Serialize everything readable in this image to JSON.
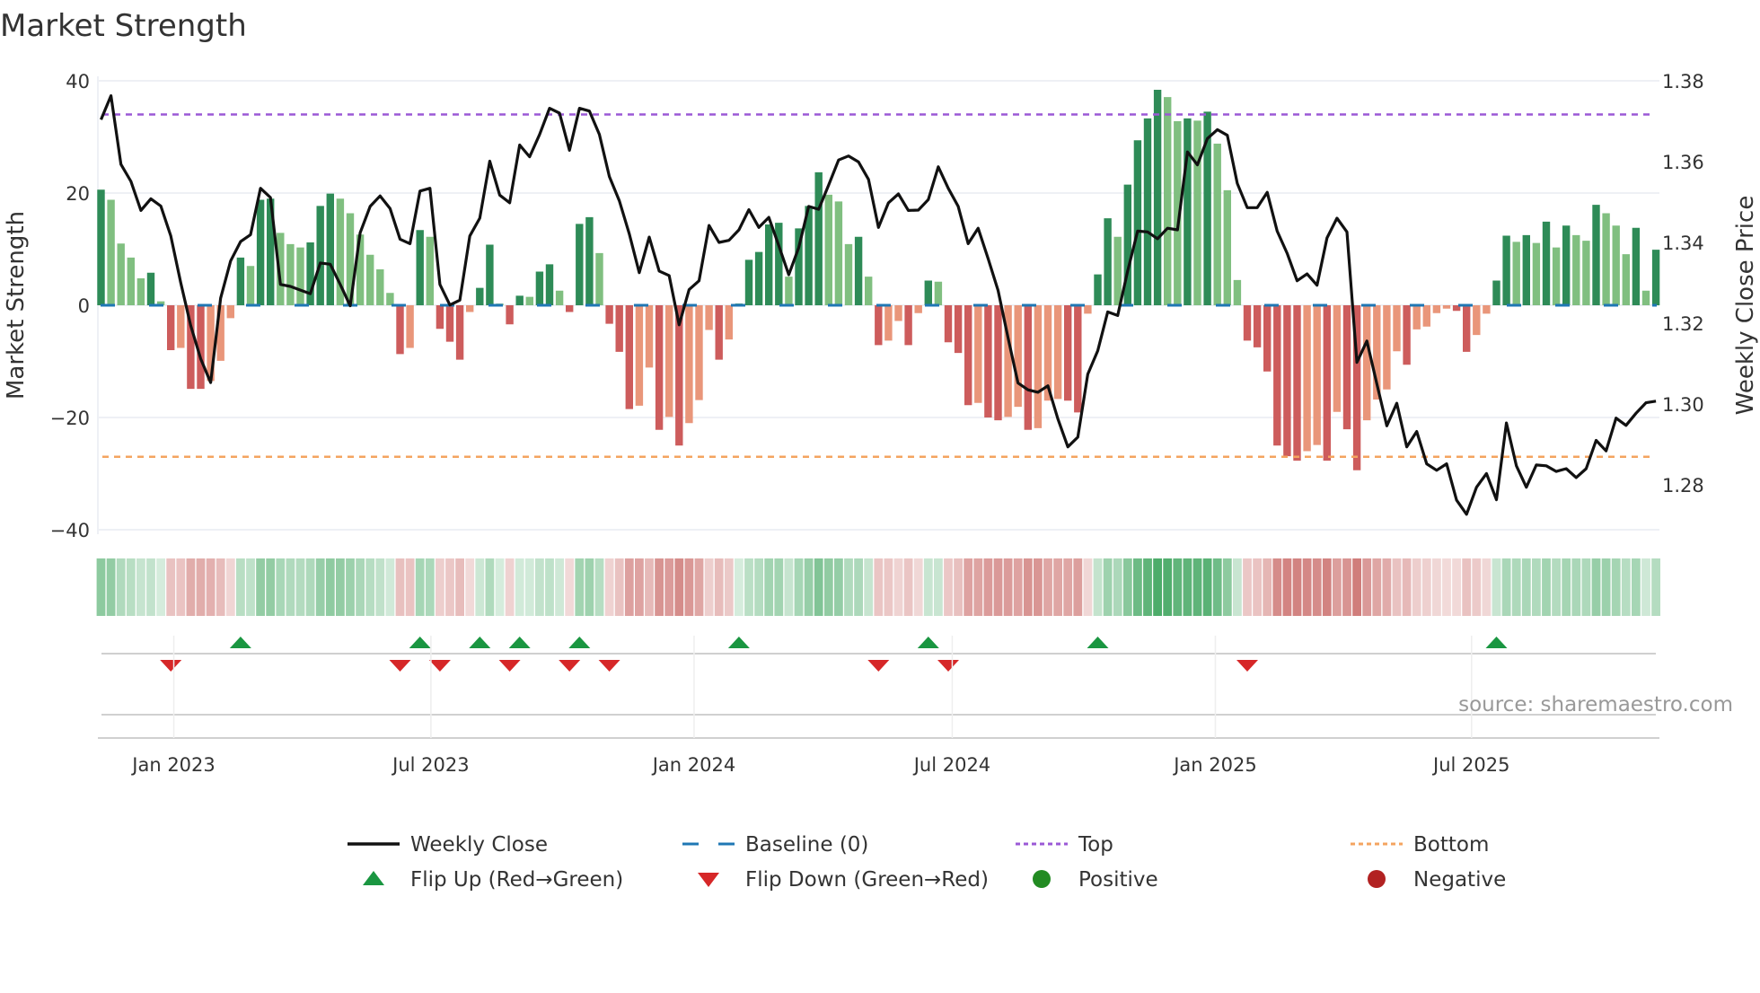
{
  "chart_data": {
    "type": "bar",
    "title": "Market Strength",
    "ylabel": "Market Strength",
    "y2label": "Weekly Close Price",
    "ylim": [
      -40,
      40
    ],
    "y2lim": [
      1.28,
      1.38
    ],
    "yticks": [
      "40",
      "20",
      "0",
      "−20",
      "−40"
    ],
    "yticks_values": [
      40,
      20,
      0,
      -20,
      -40
    ],
    "y2ticks": [
      "1.38",
      "1.36",
      "1.34",
      "1.32",
      "1.30",
      "1.28"
    ],
    "y2ticks_values": [
      1.38,
      1.36,
      1.34,
      1.32,
      1.3,
      1.28
    ],
    "xticks": [
      {
        "label": "Jan 2023",
        "week": 8.3
      },
      {
        "label": "Jul 2023",
        "week": 34.1
      },
      {
        "label": "Jan 2024",
        "week": 60.5
      },
      {
        "label": "Jul 2024",
        "week": 86.4
      },
      {
        "label": "Jan 2025",
        "week": 112.8
      },
      {
        "label": "Jul 2025",
        "week": 138.5
      }
    ],
    "top_level": 34,
    "bottom_level": -27,
    "baseline": 0,
    "strength": [
      20.6,
      18.8,
      11,
      8.5,
      4.8,
      5.8,
      0.7,
      -8,
      -7.6,
      -14.9,
      -14.9,
      -13.5,
      -9.9,
      -2.3,
      8.5,
      7,
      18.8,
      19,
      12.9,
      10.9,
      10.3,
      11.2,
      17.7,
      19.9,
      19,
      16.4,
      12.6,
      9,
      6.4,
      2.2,
      -8.7,
      -7.6,
      13.4,
      12.2,
      -4.2,
      -6.5,
      -9.7,
      -1.2,
      3.1,
      10.8,
      0.3,
      -3.4,
      1.7,
      1.5,
      6,
      7.3,
      2.6,
      -1.2,
      14.5,
      15.7,
      9.3,
      -3.3,
      -8.3,
      -18.5,
      -17.9,
      -11.1,
      -22.2,
      -19.9,
      -25,
      -21,
      -16.9,
      -4.4,
      -9.7,
      -6.1,
      0.3,
      8.1,
      9.5,
      14.4,
      14.7,
      5.1,
      13.7,
      17.7,
      23.7,
      19.7,
      18.5,
      10.9,
      12.2,
      5.1,
      -7.1,
      -6.3,
      -2.8,
      -7.1,
      -1.4,
      4.4,
      4.2,
      -6.6,
      -8.5,
      -17.8,
      -17.4,
      -20,
      -20.5,
      -19.9,
      -18.1,
      -22.2,
      -21.9,
      -17,
      -16.7,
      -17,
      -19.1,
      -1.5,
      5.5,
      15.5,
      12.2,
      21.5,
      29.4,
      33.3,
      38.4,
      37.1,
      32.8,
      33.3,
      32.9,
      34.5,
      28.8,
      20.5,
      4.5,
      -6.3,
      -7.5,
      -11.8,
      -25,
      -26.9,
      -27.7,
      -26,
      -24.9,
      -27.7,
      -19,
      -22.1,
      -29.4,
      -20.5,
      -16.8,
      -15,
      -8.2,
      -10.6,
      -4.3,
      -3.8,
      -1.4,
      -0.6,
      -1,
      -8.3,
      -5.3,
      -1.5,
      4.4,
      12.4,
      11.3,
      12.5,
      11.1,
      14.9,
      10.3,
      14.2,
      12.5,
      11.5,
      17.9,
      16.4,
      14.2,
      9.1,
      13.8,
      2.6,
      9.9
    ],
    "weekly_close": [
      1.3704,
      1.3763,
      1.3593,
      1.3551,
      1.3479,
      1.3508,
      1.349,
      1.3416,
      1.33,
      1.3194,
      1.3112,
      1.3053,
      1.3262,
      1.3354,
      1.3402,
      1.3419,
      1.3534,
      1.3511,
      1.3296,
      1.3291,
      1.3282,
      1.3273,
      1.3349,
      1.3346,
      1.3296,
      1.3243,
      1.3424,
      1.3489,
      1.3515,
      1.3484,
      1.3408,
      1.3397,
      1.3527,
      1.3534,
      1.3296,
      1.3245,
      1.3257,
      1.3416,
      1.346,
      1.3601,
      1.3517,
      1.3498,
      1.3641,
      1.3612,
      1.3667,
      1.3732,
      1.372,
      1.3628,
      1.3732,
      1.3725,
      1.3667,
      1.3563,
      1.3503,
      1.3421,
      1.3325,
      1.3413,
      1.3329,
      1.3318,
      1.3196,
      1.3283,
      1.3305,
      1.3442,
      1.34,
      1.3405,
      1.3431,
      1.3481,
      1.3437,
      1.3462,
      1.3392,
      1.332,
      1.3387,
      1.3489,
      1.3482,
      1.3542,
      1.3604,
      1.3614,
      1.3599,
      1.3556,
      1.3437,
      1.3498,
      1.352,
      1.3479,
      1.348,
      1.3506,
      1.3587,
      1.3534,
      1.3489,
      1.3397,
      1.3435,
      1.336,
      1.3281,
      1.3164,
      1.3052,
      1.3035,
      1.3029,
      1.3045,
      1.2963,
      1.2894,
      1.2918,
      1.3074,
      1.3132,
      1.3228,
      1.3219,
      1.3329,
      1.3428,
      1.3426,
      1.3409,
      1.3435,
      1.3431,
      1.3624,
      1.3592,
      1.3657,
      1.3679,
      1.3665,
      1.3546,
      1.3486,
      1.3486,
      1.3524,
      1.3428,
      1.3373,
      1.3305,
      1.3322,
      1.3294,
      1.3411,
      1.346,
      1.3426,
      1.3103,
      1.3156,
      1.305,
      1.2946,
      1.3002,
      1.2894,
      1.2932,
      1.2852,
      1.2836,
      1.2852,
      1.2762,
      1.2727,
      1.2794,
      1.2828,
      1.2763,
      1.2953,
      1.2847,
      1.2794,
      1.2849,
      1.2847,
      1.2833,
      1.284,
      1.2818,
      1.284,
      1.291,
      1.2884,
      1.2965,
      1.2947,
      1.2977,
      1.3003,
      1.3007
    ],
    "legend": {
      "placement": "bottom",
      "items": [
        {
          "label": "Weekly Close",
          "icon": "line-icon"
        },
        {
          "label": "Baseline (0)",
          "icon": "dash-icon"
        },
        {
          "label": "Top",
          "icon": "dotted-line-icon"
        },
        {
          "label": "Bottom",
          "icon": "dotted-line-icon"
        },
        {
          "label": "Flip Up (Red→Green)",
          "icon": "triangle-up-icon"
        },
        {
          "label": "Flip Down (Green→Red)",
          "icon": "triangle-down-icon"
        },
        {
          "label": "Positive",
          "icon": "circle-icon"
        },
        {
          "label": "Negative",
          "icon": "circle-icon"
        }
      ]
    },
    "source": "source: sharemaestro.com",
    "grid": true
  },
  "colors": {
    "green_dark": "#2e8b57",
    "green_light": "#80bf80",
    "red_dark": "#cd5c5c",
    "red_light": "#e9967a",
    "line": "#111111",
    "baseline": "#1f77b4",
    "top": "#9b59d6",
    "bottom": "#f4a460",
    "flip_up": "#1a9641",
    "flip_down": "#d62728",
    "positive": "#228b22",
    "negative": "#b22222"
  }
}
